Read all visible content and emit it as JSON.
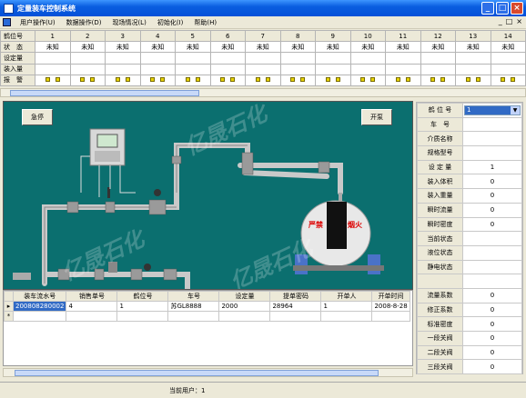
{
  "window": {
    "title": "定量装车控制系统"
  },
  "menu": [
    "用户操作(U)",
    "数据操作(D)",
    "现场情况(L)",
    "初始化(I)",
    "帮助(H)"
  ],
  "mdi_buttons": [
    "_",
    "□",
    "×"
  ],
  "top_table": {
    "row_labels": [
      "鹤位号",
      "状　态",
      "设定量",
      "装入量",
      "报　警"
    ],
    "columns": [
      "1",
      "2",
      "3",
      "4",
      "5",
      "6",
      "7",
      "8",
      "9",
      "10",
      "11",
      "12",
      "13",
      "14"
    ],
    "status": [
      "未知",
      "未知",
      "未知",
      "未知",
      "未知",
      "未知",
      "未知",
      "未知",
      "未知",
      "未知",
      "未知",
      "未知",
      "未知",
      "未知"
    ]
  },
  "scene": {
    "stop_label": "急停",
    "start_label": "开泵",
    "tank_text_left": "严禁",
    "tank_text_right": "烟火",
    "watermark": "亿晟石化"
  },
  "props": {
    "crane_label": "鹤 位 号",
    "crane_value": "1",
    "rows": [
      {
        "k": "车　号",
        "v": ""
      },
      {
        "k": "介质名称",
        "v": ""
      },
      {
        "k": "规格型号",
        "v": ""
      },
      {
        "k": "设 定 量",
        "v": "1"
      },
      {
        "k": "装入体积",
        "v": "0"
      },
      {
        "k": "装入重量",
        "v": "0"
      },
      {
        "k": "瞬时流量",
        "v": "0"
      },
      {
        "k": "瞬时密度",
        "v": "0"
      },
      {
        "k": "当前状态",
        "v": ""
      },
      {
        "k": "液位状态",
        "v": ""
      },
      {
        "k": "静电状态",
        "v": ""
      },
      {
        "k": "",
        "v": ""
      },
      {
        "k": "流量系数",
        "v": "0"
      },
      {
        "k": "修正系数",
        "v": "0"
      },
      {
        "k": "标准密度",
        "v": "0"
      },
      {
        "k": "一段关阀",
        "v": "0"
      },
      {
        "k": "二段关阀",
        "v": "0"
      },
      {
        "k": "三段关阀",
        "v": "0"
      }
    ]
  },
  "grid": {
    "headers": [
      "装车流水号",
      "销售单号",
      "鹤位号",
      "车号",
      "设定量",
      "提单密码",
      "开单人",
      "开单时间"
    ],
    "rows": [
      [
        "200808280002",
        "4",
        "1",
        "苏GL8888",
        "2000",
        "28964",
        "1",
        "2008-8-28"
      ]
    ]
  },
  "status": {
    "current_user": "当前用户：1"
  }
}
